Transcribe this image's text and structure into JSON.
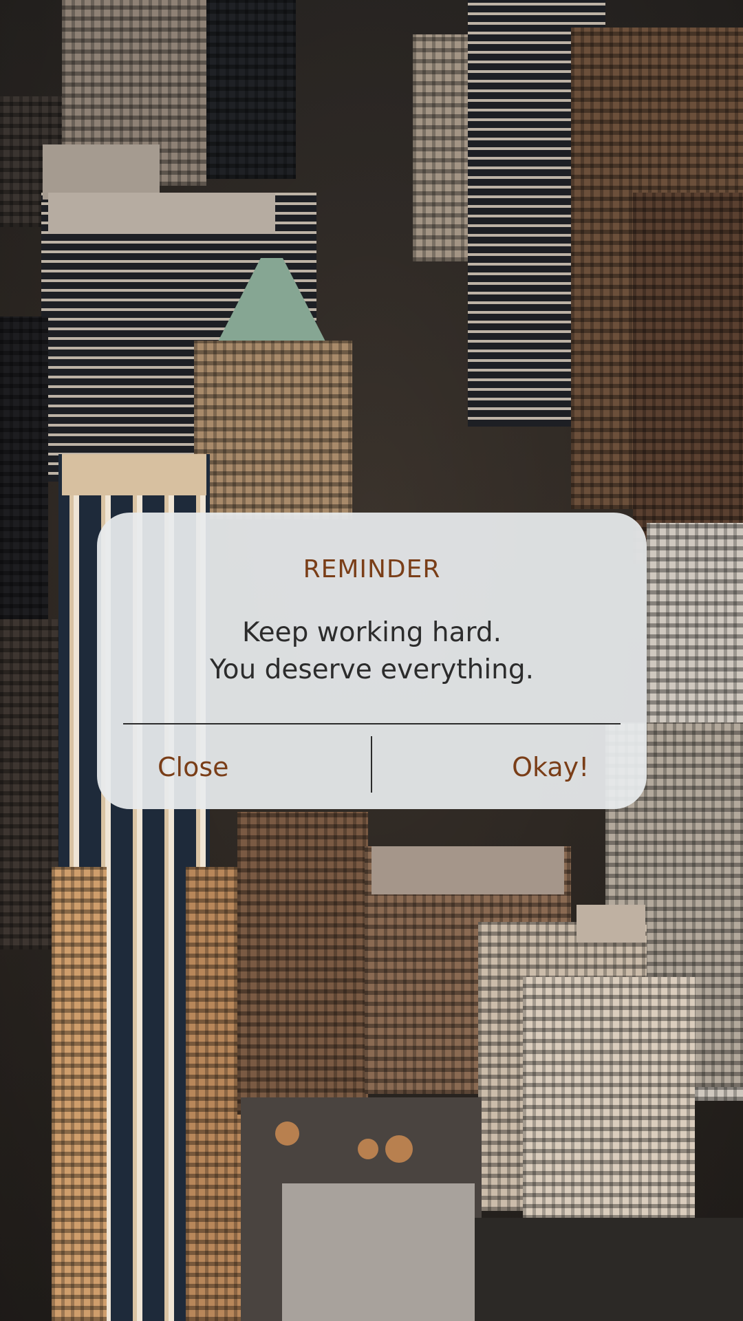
{
  "dialog": {
    "title": "REMINDER",
    "message_line_1": "Keep working hard.",
    "message_line_2": "You deserve everything.",
    "close_label": "Close",
    "okay_label": "Okay!"
  },
  "colors": {
    "accent": "#7a3e18",
    "message_text": "#2c2c2c",
    "dialog_background": "#e8ecee"
  }
}
